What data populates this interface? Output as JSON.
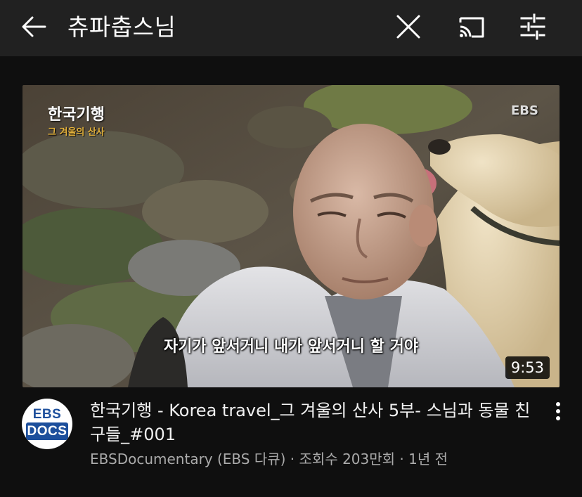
{
  "topbar": {
    "back_icon": "arrow-left-icon",
    "search_query": "츄파춥스님",
    "clear_icon": "close-icon",
    "cast_icon": "cast-icon",
    "filter_icon": "tune-icon"
  },
  "video": {
    "duration": "9:53",
    "subtitle": "자기가 앞서거니 내가 앞서거니 할 거야",
    "watermark_title": "한국기행",
    "watermark_subtitle": "그 겨울의 산사",
    "watermark_brand": "EBS",
    "title": "한국기행 - Korea travel_그 겨울의 산사 5부- 스님과 동물 친구들_#001",
    "meta": "EBSDocumentary (EBS 다큐) · 조회수 203만회 · 1년 전",
    "more_icon": "more-vertical-icon"
  },
  "channel": {
    "avatar_top": "EBS",
    "avatar_bottom": "DOCS"
  },
  "colors": {
    "background": "#0f0f0f",
    "topbar": "#212121",
    "meta_text": "#aaaaaa",
    "avatar_brand": "#1d4f9c"
  }
}
